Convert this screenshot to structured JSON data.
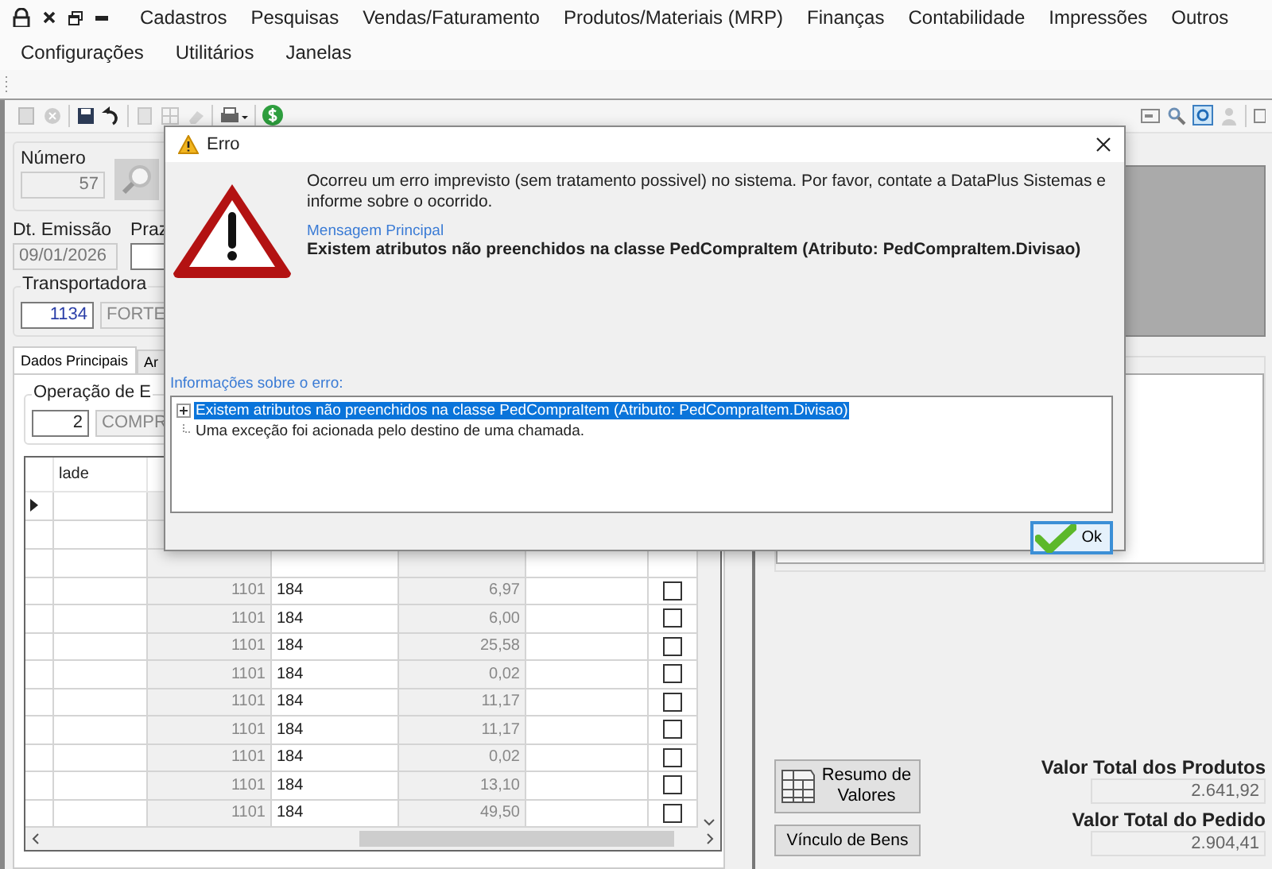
{
  "menu": {
    "top_items": [
      "Cadastros",
      "Pesquisas",
      "Vendas/Faturamento",
      "Produtos/Materiais (MRP)",
      "Finanças",
      "Contabilidade",
      "Impressões",
      "Outros"
    ],
    "wrapped_items": [
      "Configurações",
      "Utilitários",
      "Janelas"
    ]
  },
  "form": {
    "numero": {
      "label": "Número",
      "value": "57"
    },
    "dt_emissao": {
      "label": "Dt. Emissão",
      "value": "09/01/2026"
    },
    "prazo": {
      "label": "Praz"
    },
    "transportadora": {
      "label": "Transportadora",
      "code": "1134",
      "name": "FORTE"
    },
    "tabs": [
      {
        "label": "Dados Principais",
        "selected": true
      },
      {
        "label": "Ar",
        "selected": false
      }
    ],
    "operacao": {
      "label": "Operação de E",
      "code": "2",
      "name": "COMPR"
    }
  },
  "grid": {
    "columns": [
      "lade"
    ],
    "rows": [
      {
        "current": true
      },
      {
        "current": false,
        "cells": [
          "1101",
          "184",
          "6,97"
        ],
        "checked": false
      },
      {
        "current": false,
        "cells": [
          "1101",
          "184",
          "6,00"
        ],
        "checked": false
      },
      {
        "current": false,
        "cells": [
          "1101",
          "184",
          "25,58"
        ],
        "checked": false
      },
      {
        "current": false,
        "cells": [
          "1101",
          "184",
          "0,02"
        ],
        "checked": false
      },
      {
        "current": false,
        "cells": [
          "1101",
          "184",
          "11,17"
        ],
        "checked": false
      },
      {
        "current": false,
        "cells": [
          "1101",
          "184",
          "11,17"
        ],
        "checked": false
      },
      {
        "current": false,
        "cells": [
          "1101",
          "184",
          "0,02"
        ],
        "checked": false
      },
      {
        "current": false,
        "cells": [
          "1101",
          "184",
          "13,10"
        ],
        "checked": false
      },
      {
        "current": false,
        "cells": [
          "1101",
          "184",
          "49,50"
        ],
        "checked": false
      }
    ]
  },
  "buttons": [
    {
      "label": "Resumo de Valores",
      "kind": "with_icon"
    },
    {
      "label": "Vínculo de Bens",
      "kind": "plain"
    }
  ],
  "totals": [
    {
      "label": "Valor Total dos Produtos",
      "value": "2.641,92"
    },
    {
      "label": "Valor Total do Pedido",
      "value": "2.904,41"
    }
  ],
  "dialog": {
    "title": "Erro",
    "message": "Ocorreu um erro imprevisto (sem tratamento possivel) no sistema. Por favor, contate a DataPlus Sistemas e informe sobre o ocorrido.",
    "main_message_label": "Mensagem Principal",
    "main_message": "Existem atributos não preenchidos na classe PedCompraItem (Atributo: PedCompraItem.Divisao)",
    "details_label": "Informações sobre o erro:",
    "details": [
      {
        "kind": "group",
        "text": "Existem atributos não preenchidos na classe PedCompraItem (Atributo: PedCompraItem.Divisao)",
        "selected": true,
        "expanded": false
      },
      {
        "kind": "leaf",
        "text": "Uma exceção foi acionada pelo destino de uma chamada.",
        "selected": false
      }
    ],
    "ok_button": "Ok"
  }
}
